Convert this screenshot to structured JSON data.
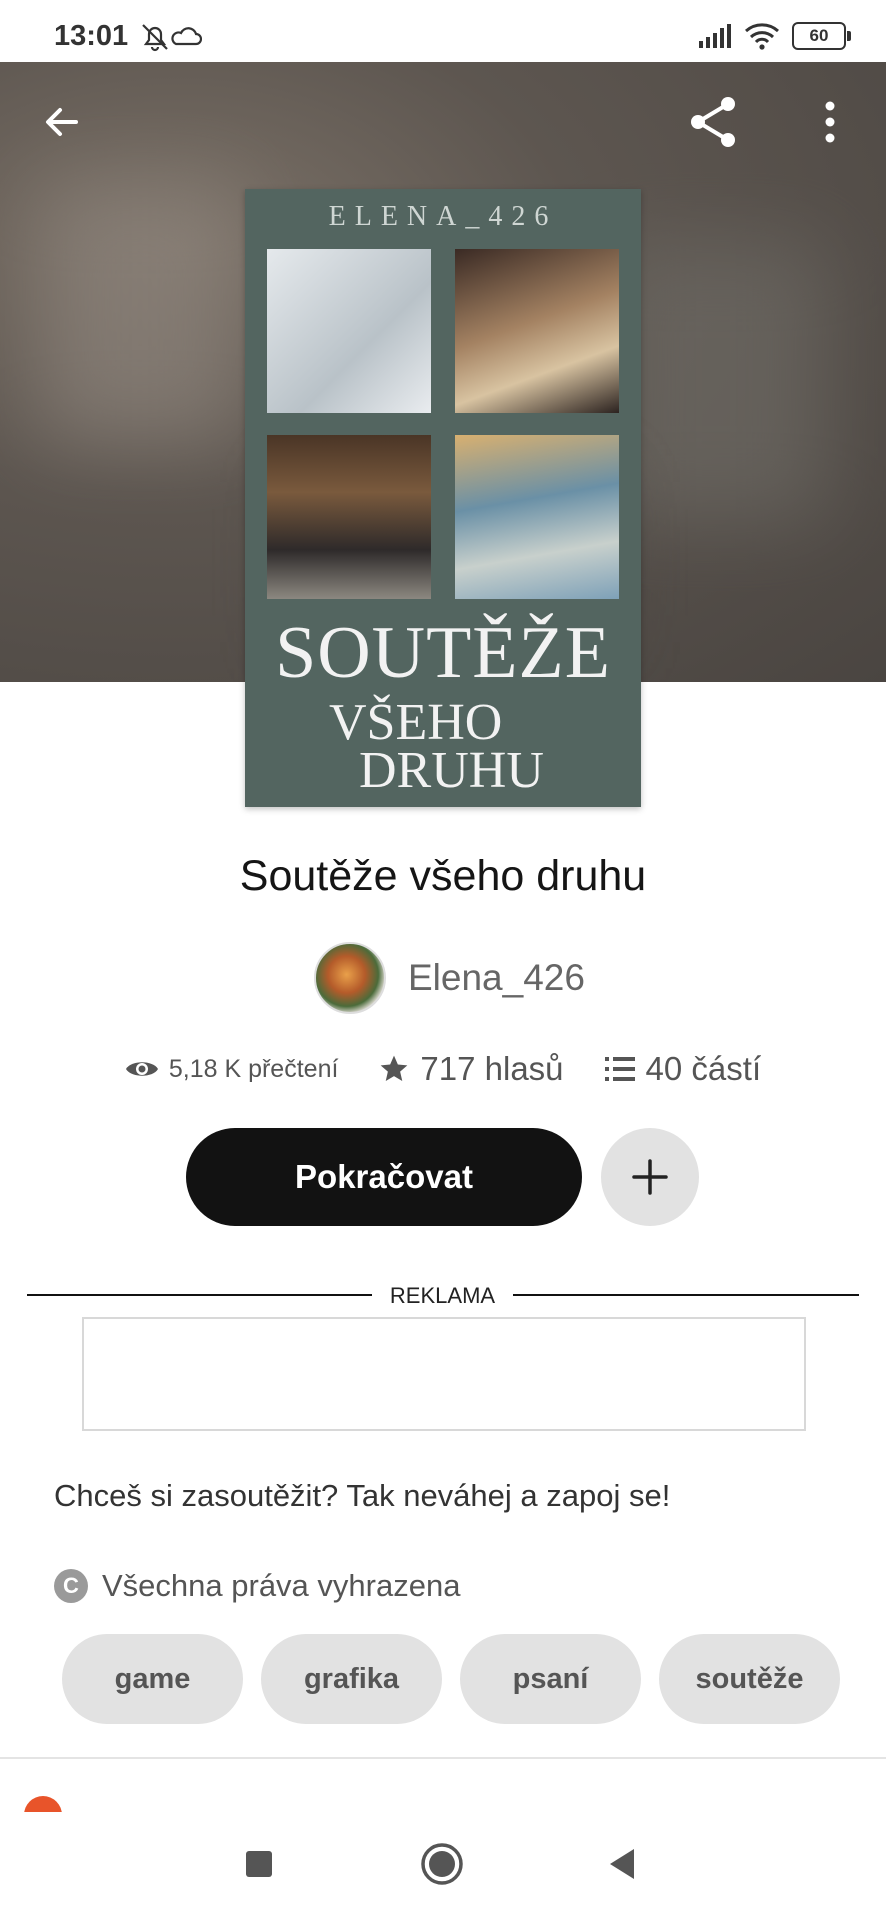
{
  "status_bar": {
    "time": "13:01",
    "battery": "60"
  },
  "cover": {
    "author": "ELENA_426",
    "title_line1": "SOUTĚŽE",
    "title_line2": "VŠEHO",
    "title_line3": "DRUHU"
  },
  "story": {
    "title": "Soutěže všeho druhu",
    "author": "Elena_426",
    "reads": "5,18 K přečtení",
    "votes": "717 hlasů",
    "parts": "40 částí",
    "description": "Chceš si zasoutěžit? Tak neváhej a zapoj se!",
    "rights": "Všechna práva vyhrazena",
    "rights_symbol": "C"
  },
  "actions": {
    "continue_label": "Pokračovat"
  },
  "ad": {
    "label": "REKLAMA"
  },
  "tags": [
    "game",
    "grafika",
    "psaní",
    "soutěže"
  ],
  "icons": {
    "back": "arrow-left-icon",
    "share": "share-icon",
    "more": "more-vertical-icon",
    "reads": "eye-icon",
    "votes": "star-icon",
    "parts": "list-icon",
    "add": "plus-icon"
  },
  "colors": {
    "cover_bg": "#536560",
    "button_primary": "#121212",
    "chip_bg": "#e2e2e2"
  }
}
